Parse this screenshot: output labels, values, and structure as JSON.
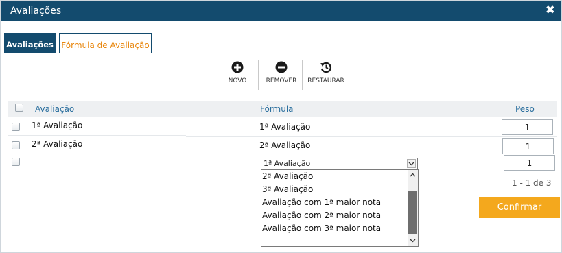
{
  "window": {
    "title": "Avaliações",
    "close_glyph": "✖"
  },
  "tabs": [
    {
      "label": "Avaliações",
      "active": false
    },
    {
      "label": "Fórmula de Avaliação",
      "active": true
    }
  ],
  "toolbar": {
    "novo_label": "NOVO",
    "remover_label": "REMOVER",
    "restaurar_label": "RESTAURAR",
    "icons": [
      "plus-circle-icon",
      "minus-circle-icon",
      "restore-history-icon"
    ]
  },
  "grid": {
    "columns": {
      "avaliacao": "Avaliação",
      "formula": "Fórmula",
      "peso": "Peso"
    },
    "rows": [
      {
        "avaliacao": "1ª Avaliação",
        "formula": "1ª Avaliação",
        "peso": "1"
      },
      {
        "avaliacao": "2ª Avaliação",
        "formula": "2ª Avaliação",
        "peso": "1"
      },
      {
        "avaliacao": "",
        "formula_selected": "1ª Avaliação",
        "peso": "1"
      }
    ]
  },
  "dropdown": {
    "options": [
      "2ª Avaliação",
      "3ª Avaliação",
      "Avaliação com 1ª maior nota",
      "Avaliação com 2ª maior nota",
      "Avaliação com 3ª maior nota"
    ]
  },
  "pager": {
    "text": "1 - 1 de 3"
  },
  "footer": {
    "confirm_label": "Confirmar"
  },
  "colors": {
    "header": "#134b6e",
    "accent": "#e8860c",
    "confirm": "#f4a81d",
    "column_header_text": "#2b6f9e"
  }
}
